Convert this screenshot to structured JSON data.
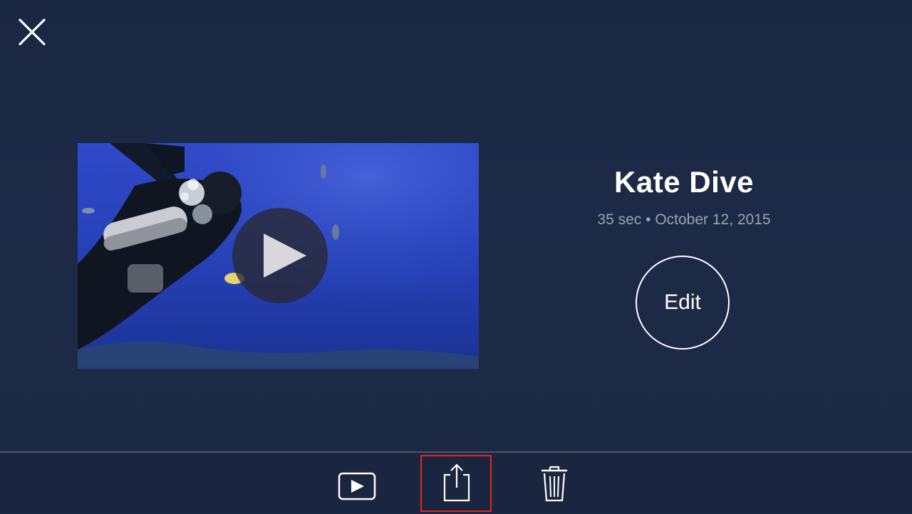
{
  "header": {
    "close_icon": "close-icon"
  },
  "video": {
    "title": "Kate Dive",
    "duration": "35 sec",
    "separator": "•",
    "date": "October 12, 2015",
    "meta_text": "35 sec • October 12, 2015",
    "thumbnail_icon": "play-icon"
  },
  "actions": {
    "edit_label": "Edit"
  },
  "toolbar": {
    "items": [
      {
        "icon": "play-icon"
      },
      {
        "icon": "share-icon",
        "selected": true
      },
      {
        "icon": "trash-icon"
      }
    ]
  },
  "colors": {
    "background": "#1b2944",
    "highlight": "#e0261b",
    "meta_text": "#9aa3b2"
  }
}
